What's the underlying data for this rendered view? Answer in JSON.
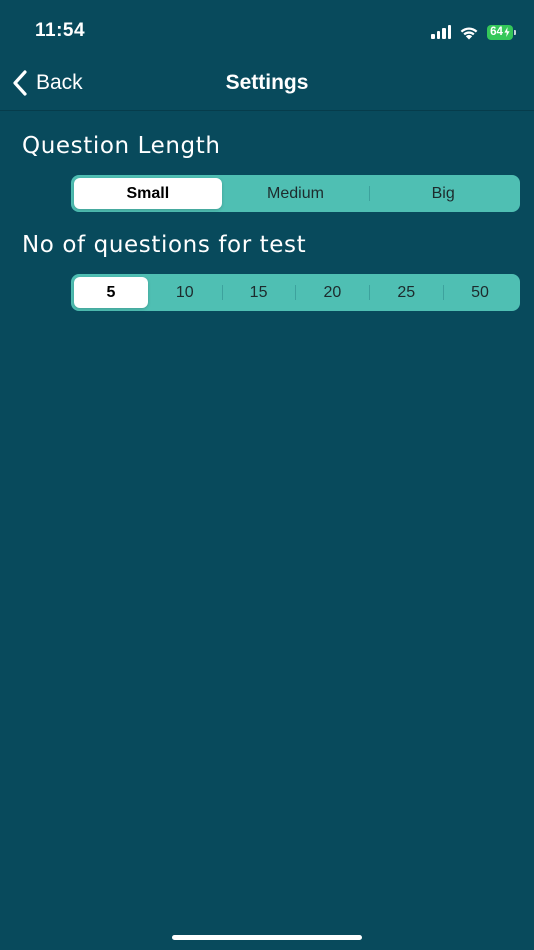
{
  "status_bar": {
    "time": "11:54",
    "battery": "64",
    "icons": [
      "cellular-signal-icon",
      "wifi-icon",
      "battery-charging-icon"
    ]
  },
  "nav": {
    "back_label": "Back",
    "title": "Settings"
  },
  "question_length": {
    "title": "Question Length",
    "options": [
      "Small",
      "Medium",
      "Big"
    ],
    "selected": "Small"
  },
  "question_count": {
    "title": "No of questions for test",
    "options": [
      "5",
      "10",
      "15",
      "20",
      "25",
      "50"
    ],
    "selected": "5"
  },
  "colors": {
    "background": "#084a5c",
    "segment_background": "#4fbfb3",
    "segment_selected": "#ffffff",
    "battery": "#35c759"
  }
}
